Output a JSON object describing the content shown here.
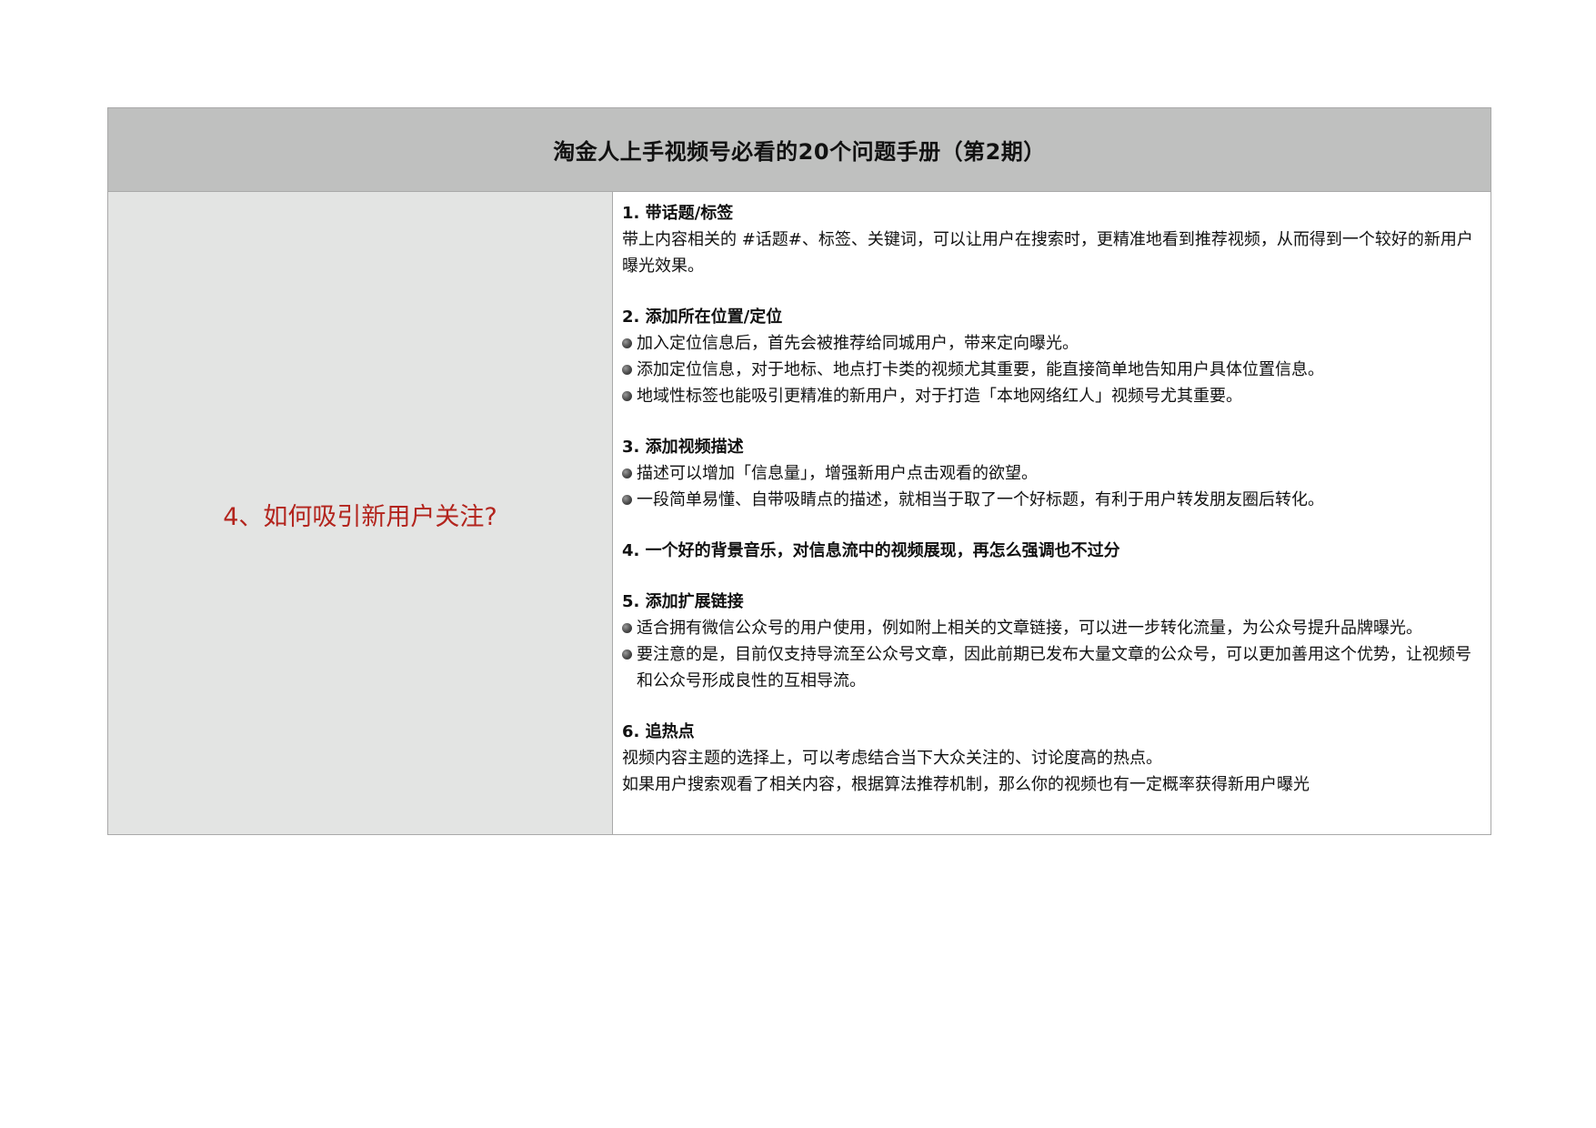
{
  "header": {
    "title": "淘金人上手视频号必看的20个问题手册（第2期）"
  },
  "question": {
    "text": "4、如何吸引新用户关注?"
  },
  "sections": [
    {
      "title": "1. 带话题/标签",
      "paragraphs": [
        "带上内容相关的 #话题#、标签、关键词，可以让用户在搜索时，更精准地看到推荐视频，从而得到一个较好的新用户曝光效果。"
      ],
      "bullets": []
    },
    {
      "title": "2. 添加所在位置/定位",
      "paragraphs": [],
      "bullets": [
        "加入定位信息后，首先会被推荐给同城用户，带来定向曝光。",
        "添加定位信息，对于地标、地点打卡类的视频尤其重要，能直接简单地告知用户具体位置信息。",
        "地域性标签也能吸引更精准的新用户，对于打造「本地网络红人」视频号尤其重要。"
      ]
    },
    {
      "title": "3. 添加视频描述",
      "paragraphs": [],
      "bullets": [
        "描述可以增加「信息量」，增强新用户点击观看的欲望。",
        "一段简单易懂、自带吸睛点的描述，就相当于取了一个好标题，有利于用户转发朋友圈后转化。"
      ]
    },
    {
      "title": "4. 一个好的背景音乐，对信息流中的视频展现，再怎么强调也不过分",
      "paragraphs": [],
      "bullets": []
    },
    {
      "title": "5. 添加扩展链接",
      "paragraphs": [],
      "bullets": [
        "适合拥有微信公众号的用户使用，例如附上相关的文章链接，可以进一步转化流量，为公众号提升品牌曝光。",
        "要注意的是，目前仅支持导流至公众号文章，因此前期已发布大量文章的公众号，可以更加善用这个优势，让视频号和公众号形成良性的互相导流。"
      ]
    },
    {
      "title": "6. 追热点",
      "paragraphs": [
        "视频内容主题的选择上，可以考虑结合当下大众关注的、讨论度高的热点。",
        "如果用户搜索观看了相关内容，根据算法推荐机制，那么你的视频也有一定概率获得新用户曝光"
      ],
      "bullets": []
    }
  ]
}
